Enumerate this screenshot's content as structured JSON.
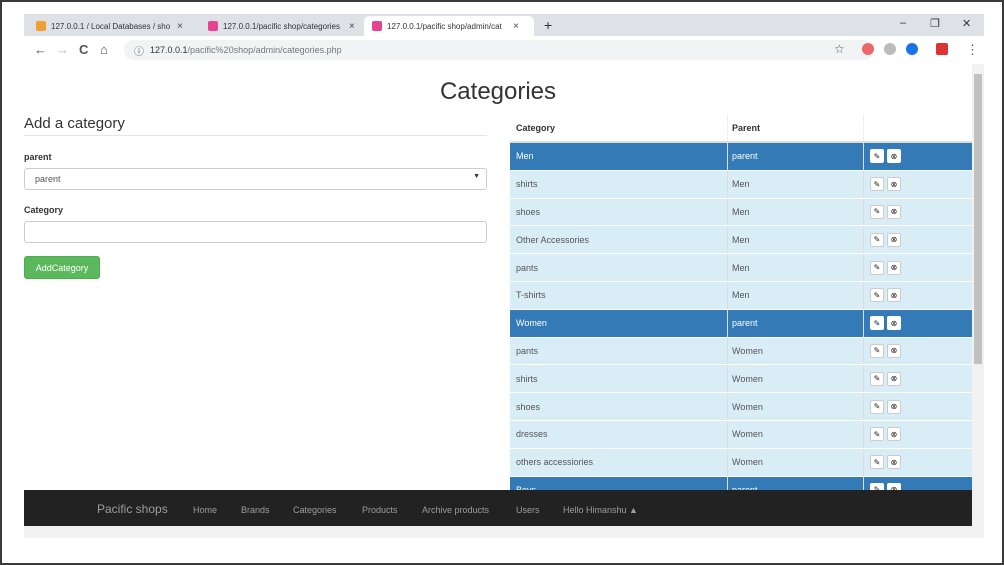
{
  "browser": {
    "tabs": [
      {
        "title": "127.0.0.1 / Local Databases / sho",
        "close": "×",
        "favicon_color": "#f0a030"
      },
      {
        "title": "127.0.0.1/pacific shop/categories",
        "close": "×",
        "favicon_color": "#e84393"
      },
      {
        "title": "127.0.0.1/pacific shop/admin/cat",
        "close": "×",
        "favicon_color": "#e84393"
      }
    ],
    "new_tab": "+",
    "minimize": "–",
    "maximize": "❐",
    "close": "✕",
    "back": "←",
    "forward": "→",
    "reload": "C",
    "home": "⌂",
    "info": "ⓘ",
    "url_host": "127.0.0.1",
    "url_path": "/pacific%20shop/admin/categories.php",
    "star": "☆",
    "menu": "⋮"
  },
  "page": {
    "title": "Categories"
  },
  "form": {
    "heading": "Add a category",
    "parent_label": "parent",
    "parent_selected": "parent",
    "caret": "▼",
    "category_label": "Category",
    "category_value": "",
    "submit_label": "AddCategory"
  },
  "table": {
    "headers": {
      "category": "Category",
      "parent": "Parent"
    },
    "rows": [
      {
        "category": "Men",
        "parent": "parent",
        "type": "parent"
      },
      {
        "category": "shirts",
        "parent": "Men",
        "type": "child"
      },
      {
        "category": "shoes",
        "parent": "Men",
        "type": "child"
      },
      {
        "category": "Other Accessories",
        "parent": "Men",
        "type": "child"
      },
      {
        "category": "pants",
        "parent": "Men",
        "type": "child"
      },
      {
        "category": "T-shirts",
        "parent": "Men",
        "type": "child"
      },
      {
        "category": "Women",
        "parent": "parent",
        "type": "parent"
      },
      {
        "category": "pants",
        "parent": "Women",
        "type": "child"
      },
      {
        "category": "shirts",
        "parent": "Women",
        "type": "child"
      },
      {
        "category": "shoes",
        "parent": "Women",
        "type": "child"
      },
      {
        "category": "dresses",
        "parent": "Women",
        "type": "child"
      },
      {
        "category": "others accessiories",
        "parent": "Women",
        "type": "child"
      },
      {
        "category": "Boys",
        "parent": "parent",
        "type": "parent"
      }
    ],
    "edit_icon": "✎",
    "delete_icon": "⊗"
  },
  "navbar": {
    "brand": "Pacific shops",
    "links": [
      "Home",
      "Brands",
      "Categories",
      "Products",
      "Archive products",
      "Users"
    ],
    "user": "Hello Himanshu ▲"
  },
  "colors": {
    "parent_row": "#337ab7",
    "child_row": "#d9edf7",
    "button_green": "#5cb85c",
    "navbar_bg": "#222222"
  }
}
